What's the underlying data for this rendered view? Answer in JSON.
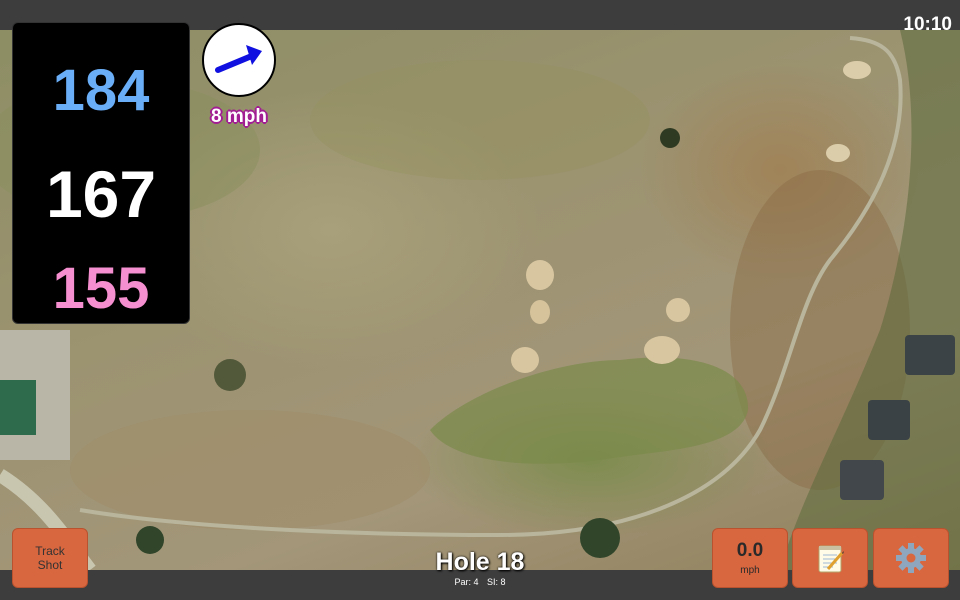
{
  "status": {
    "time": "10:10"
  },
  "distances": {
    "back": "184",
    "middle": "167",
    "front": "155"
  },
  "colors": {
    "back": "#6aaef7",
    "middle": "#ffffff",
    "front": "#f58fcf",
    "button": "#d8663f",
    "wind_arrow": "#1010e0"
  },
  "wind": {
    "speed_label": "8 mph",
    "direction_icon": "arrow-icon"
  },
  "buttons": {
    "track_shot_line1": "Track",
    "track_shot_line2": "Shot",
    "speed_value": "0.0",
    "speed_unit": "mph",
    "notes_icon": "notepad-icon",
    "settings_icon": "gear-icon"
  },
  "hole": {
    "title": "Hole 18",
    "par": "Par: 4",
    "si": "SI: 8"
  },
  "map": {
    "type": "satellite",
    "icon": "golf-hole-aerial-map"
  }
}
